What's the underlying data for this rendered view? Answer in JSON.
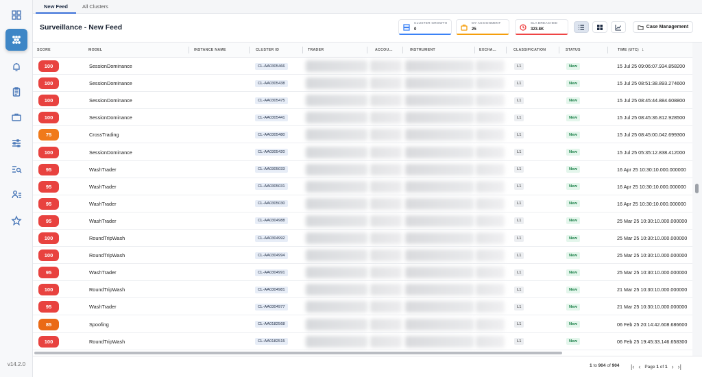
{
  "app": {
    "version": "v14.2.0"
  },
  "tabs": [
    {
      "label": "New Feed",
      "active": true
    },
    {
      "label": "All Clusters",
      "active": false
    }
  ],
  "header": {
    "title": "Surveillance - New Feed",
    "stats": [
      {
        "label": "CLUSTER GROWTH",
        "value": "0",
        "color": "#3b82f6",
        "icon": "layers-icon"
      },
      {
        "label": "MY ASSIGNMENT",
        "value": "25",
        "color": "#f59e0b",
        "icon": "briefcase-icon"
      },
      {
        "label": "SLA BREACHED",
        "value": "323.8K",
        "color": "#ef4444",
        "icon": "clock-icon"
      }
    ],
    "case_management_label": "Case Management"
  },
  "table": {
    "columns": [
      "SCORE",
      "MODEL",
      "INSTANCE NAME",
      "CLUSTER ID",
      "TRADER",
      "ACCOU...",
      "INSTRUMENT",
      "EXCHA...",
      "CLASSIFICATION",
      "STATUS",
      "TIME (UTC)"
    ],
    "rows": [
      {
        "score": "100",
        "model": "SessionDominance",
        "cluster": "CL-AA0305466",
        "class": "L1",
        "status": "New",
        "time": "15 Jul 25 09:06:07.934.858200"
      },
      {
        "score": "100",
        "model": "SessionDominance",
        "cluster": "CL-AA0305438",
        "class": "L1",
        "status": "New",
        "time": "15 Jul 25 08:51:38.893.274600"
      },
      {
        "score": "100",
        "model": "SessionDominance",
        "cluster": "CL-AA0305475",
        "class": "L1",
        "status": "New",
        "time": "15 Jul 25 08:45:44.884.608800"
      },
      {
        "score": "100",
        "model": "SessionDominance",
        "cluster": "CL-AA0305441",
        "class": "L1",
        "status": "New",
        "time": "15 Jul 25 08:45:36.812.928500"
      },
      {
        "score": "75",
        "model": "CrossTrading",
        "cluster": "CL-AA0305480",
        "class": "L1",
        "status": "New",
        "time": "15 Jul 25 08:45:00.042.699300"
      },
      {
        "score": "100",
        "model": "SessionDominance",
        "cluster": "CL-AA0305420",
        "class": "L1",
        "status": "New",
        "time": "15 Jul 25 05:35:12.838.412000"
      },
      {
        "score": "95",
        "model": "WashTrader",
        "cluster": "CL-AA0305033",
        "class": "L1",
        "status": "New",
        "time": "16 Apr 25 10:30:10.000.000000"
      },
      {
        "score": "95",
        "model": "WashTrader",
        "cluster": "CL-AA0305031",
        "class": "L1",
        "status": "New",
        "time": "16 Apr 25 10:30:10.000.000000"
      },
      {
        "score": "95",
        "model": "WashTrader",
        "cluster": "CL-AA0305030",
        "class": "L1",
        "status": "New",
        "time": "16 Apr 25 10:30:10.000.000000"
      },
      {
        "score": "95",
        "model": "WashTrader",
        "cluster": "CL-AA0304988",
        "class": "L1",
        "status": "New",
        "time": "25 Mar 25 10:30:10.000.000000"
      },
      {
        "score": "100",
        "model": "RoundTripWash",
        "cluster": "CL-AA0304992",
        "class": "L1",
        "status": "New",
        "time": "25 Mar 25 10:30:10.000.000000"
      },
      {
        "score": "100",
        "model": "RoundTripWash",
        "cluster": "CL-AA0304994",
        "class": "L1",
        "status": "New",
        "time": "25 Mar 25 10:30:10.000.000000"
      },
      {
        "score": "95",
        "model": "WashTrader",
        "cluster": "CL-AA0304991",
        "class": "L1",
        "status": "New",
        "time": "25 Mar 25 10:30:10.000.000000"
      },
      {
        "score": "100",
        "model": "RoundTripWash",
        "cluster": "CL-AA0304981",
        "class": "L1",
        "status": "New",
        "time": "21 Mar 25 10:30:10.000.000000"
      },
      {
        "score": "95",
        "model": "WashTrader",
        "cluster": "CL-AA0304977",
        "class": "L1",
        "status": "New",
        "time": "21 Mar 25 10:30:10.000.000000"
      },
      {
        "score": "85",
        "model": "Spoofing",
        "cluster": "CL-AA0182568",
        "class": "L1",
        "status": "New",
        "time": "06 Feb 25 20:14:42.608.686600"
      },
      {
        "score": "100",
        "model": "RoundTripWash",
        "cluster": "CL-AA0182515",
        "class": "L1",
        "status": "New",
        "time": "06 Feb 25 19:45:33.146.658300"
      }
    ]
  },
  "colors": {
    "score_high": "#e8423f",
    "score_mid": "#f07a1a",
    "score_85": "#ea6a16"
  },
  "footer": {
    "range_start": "1",
    "range_to": "to",
    "range_end": "904",
    "range_of": "of",
    "total": "904",
    "page_label": "Page",
    "page_current": "1",
    "page_of": "of",
    "page_total": "1"
  }
}
